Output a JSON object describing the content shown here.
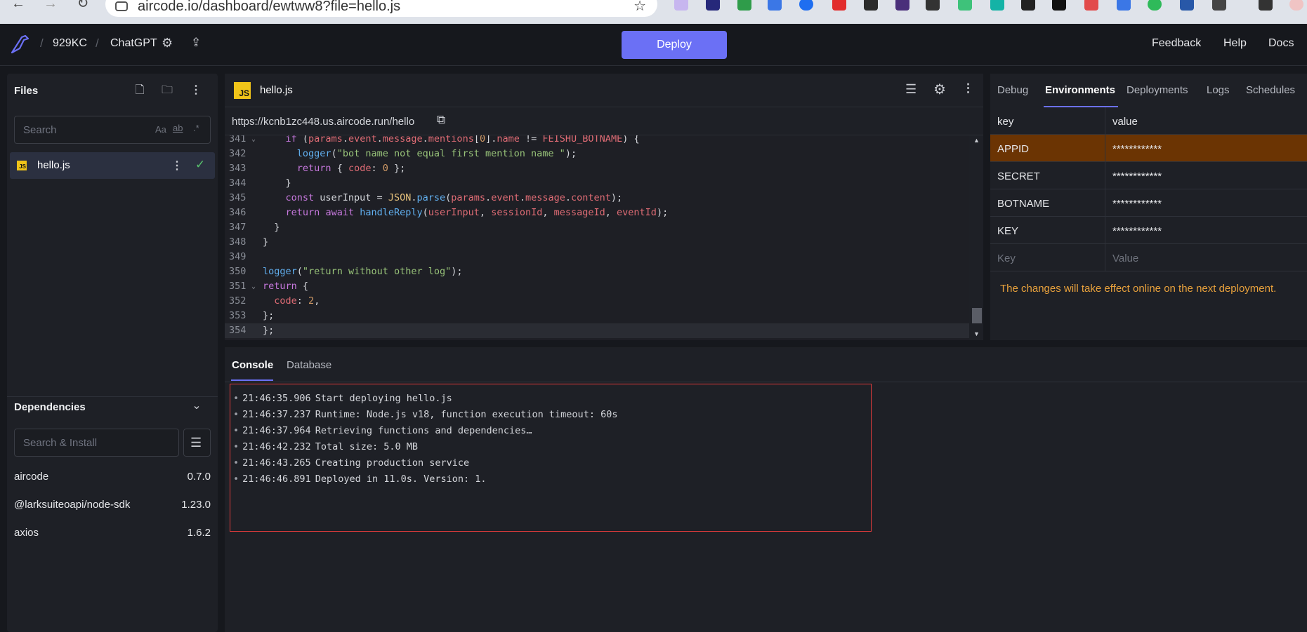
{
  "browser": {
    "url": "aircode.io/dashboard/ewtww8?file=hello.js"
  },
  "header": {
    "team": "929KC",
    "project": "ChatGPT",
    "deploy_label": "Deploy",
    "links": [
      "Feedback",
      "Help",
      "Docs"
    ]
  },
  "files_panel": {
    "title": "Files",
    "search_placeholder": "Search",
    "search_options": [
      "Aa",
      "ab",
      ".*"
    ],
    "files": [
      {
        "name": "hello.js",
        "badge": "JS"
      }
    ]
  },
  "dependencies": {
    "title": "Dependencies",
    "search_placeholder": "Search & Install",
    "items": [
      {
        "name": "aircode",
        "version": "0.7.0"
      },
      {
        "name": "@larksuiteoapi/node-sdk",
        "version": "1.23.0"
      },
      {
        "name": "axios",
        "version": "1.6.2"
      }
    ]
  },
  "editor": {
    "filename": "hello.js",
    "badge": "JS",
    "endpoint_url": "https://kcnb1zc448.us.aircode.run/hello",
    "lines": [
      {
        "n": "341",
        "fold": true,
        "html": "    <span class='kw'>if</span> (<span class='var'>params</span>.<span class='var'>event</span>.<span class='var'>message</span>.<span class='var'>mentions</span>[<span class='num'>0</span>].<span class='var'>name</span> != <span class='var'>FEISHU_BOTNAME</span>) {"
      },
      {
        "n": "342",
        "html": "      <span class='fn'>logger</span>(<span class='str'>\"bot name not equal first mention name \"</span>);"
      },
      {
        "n": "343",
        "html": "      <span class='kw'>return</span> { <span class='var'>code</span>: <span class='num'>0</span> };"
      },
      {
        "n": "344",
        "html": "    }"
      },
      {
        "n": "345",
        "html": "    <span class='kw'>const</span> userInput = <span class='cst'>JSON</span>.<span class='fn'>parse</span>(<span class='var'>params</span>.<span class='var'>event</span>.<span class='var'>message</span>.<span class='var'>content</span>);"
      },
      {
        "n": "346",
        "html": "    <span class='kw'>return</span> <span class='kw'>await</span> <span class='fn'>handleReply</span>(<span class='var'>userInput</span>, <span class='var'>sessionId</span>, <span class='var'>messageId</span>, <span class='var'>eventId</span>);"
      },
      {
        "n": "347",
        "html": "  }"
      },
      {
        "n": "348",
        "html": "}"
      },
      {
        "n": "349",
        "html": ""
      },
      {
        "n": "350",
        "html": "<span class='fn'>logger</span>(<span class='str'>\"return without other log\"</span>);"
      },
      {
        "n": "351",
        "fold": true,
        "html": "<span class='kw'>return</span> {"
      },
      {
        "n": "352",
        "html": "  <span class='var'>code</span>: <span class='num'>2</span>,"
      },
      {
        "n": "353",
        "html": "};"
      },
      {
        "n": "354",
        "current": true,
        "html": "};"
      }
    ]
  },
  "env_panel": {
    "tabs": [
      "Debug",
      "Environments",
      "Deployments",
      "Logs",
      "Schedules"
    ],
    "active_tab": "Environments",
    "columns": [
      "key",
      "value"
    ],
    "rows": [
      {
        "key": "APPID",
        "value": "************"
      },
      {
        "key": "SECRET",
        "value": "************"
      },
      {
        "key": "BOTNAME",
        "value": "************"
      },
      {
        "key": "KEY",
        "value": "************"
      }
    ],
    "new_key_placeholder": "Key",
    "new_value_placeholder": "Value",
    "note": "The changes will take effect online on the next deployment.",
    "selected_color": "#6b3403"
  },
  "console": {
    "tabs": [
      "Console",
      "Database"
    ],
    "active_tab": "Console",
    "logs": [
      {
        "time": "21:46:35.906",
        "msg": "Start deploying hello.js"
      },
      {
        "time": "21:46:37.237",
        "msg": "Runtime: Node.js v18, function execution timeout: 60s"
      },
      {
        "time": "21:46:37.964",
        "msg": "Retrieving functions and dependencies…"
      },
      {
        "time": "21:46:42.232",
        "msg": "Total size: 5.0 MB"
      },
      {
        "time": "21:46:43.265",
        "msg": "Creating production service"
      },
      {
        "time": "21:46:46.891",
        "msg": "Deployed in 11.0s. Version: 1."
      }
    ]
  },
  "colors": {
    "accent": "#6b70f5",
    "warning_text": "#e8a13c",
    "highlight_border": "#e23b3b"
  }
}
